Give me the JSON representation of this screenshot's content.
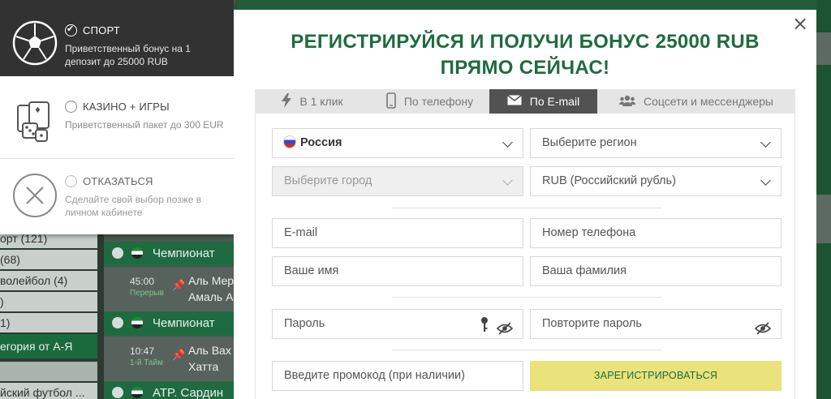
{
  "background": {
    "left_items": [
      {
        "label": "орт (121)"
      },
      {
        "label": "(68)"
      },
      {
        "label": "волейбол (4)"
      },
      {
        "label": ")"
      },
      {
        "label": "1)"
      }
    ],
    "left_category": "егория от А-Я",
    "left_bottom_item": "йский футбол ...",
    "championships": [
      "Чемпионат",
      "Чемпионат",
      "ATP. Сардин"
    ],
    "matches": [
      {
        "time": "45:00",
        "status": "Перерыв",
        "team1": "Аль Мер",
        "team2": "Амаль А"
      },
      {
        "time": "10:47",
        "status": "1-й Тайм",
        "team1": "Аль Вах",
        "team2": "Хатта"
      }
    ]
  },
  "bonus_panel": {
    "options": [
      {
        "title": "Спорт",
        "description": "Приветственный бонус на 1 депозит до 25000 RUB",
        "selected": true,
        "icon": "soccer-ball-icon"
      },
      {
        "title": "Казино + игры",
        "description": "Приветственный пакет до 300 EUR",
        "selected": false,
        "icon": "casino-cards-dice-icon"
      },
      {
        "title": "Отказаться",
        "description": "Сделайте свой выбор позже в личном кабинете",
        "selected": false,
        "icon": "decline-x-icon"
      }
    ]
  },
  "modal": {
    "headline_line1": "РЕГИСТРИРУЙСЯ И ПОЛУЧИ БОНУС 25000 RUB",
    "headline_line2": "ПРЯМО СЕЙЧАС!",
    "close_icon": "×",
    "tabs": [
      {
        "label": "В 1 клик",
        "icon": "lightning-icon",
        "active": false
      },
      {
        "label": "По телефону",
        "icon": "phone-icon",
        "active": false
      },
      {
        "label": "По E-mail",
        "icon": "envelope-icon",
        "active": true
      },
      {
        "label": "Соцсети и мессенджеры",
        "icon": "people-icon",
        "active": false
      }
    ],
    "form": {
      "country": "Россия",
      "region_placeholder": "Выберите регион",
      "city_placeholder": "Выберите город",
      "currency": "RUB (Российский рубль)",
      "email_placeholder": "E-mail",
      "phone_placeholder": "Номер телефона",
      "first_name_placeholder": "Ваше имя",
      "last_name_placeholder": "Ваша фамилия",
      "password_placeholder": "Пароль",
      "repeat_password_placeholder": "Повторите пароль",
      "promo_placeholder": "Введите промокод (при наличии)",
      "submit_label": "Зарегистрироваться"
    },
    "colors": {
      "brand_green": "#1f6b41",
      "submit_yellow": "#eae27a",
      "active_tab": "#525252"
    }
  }
}
